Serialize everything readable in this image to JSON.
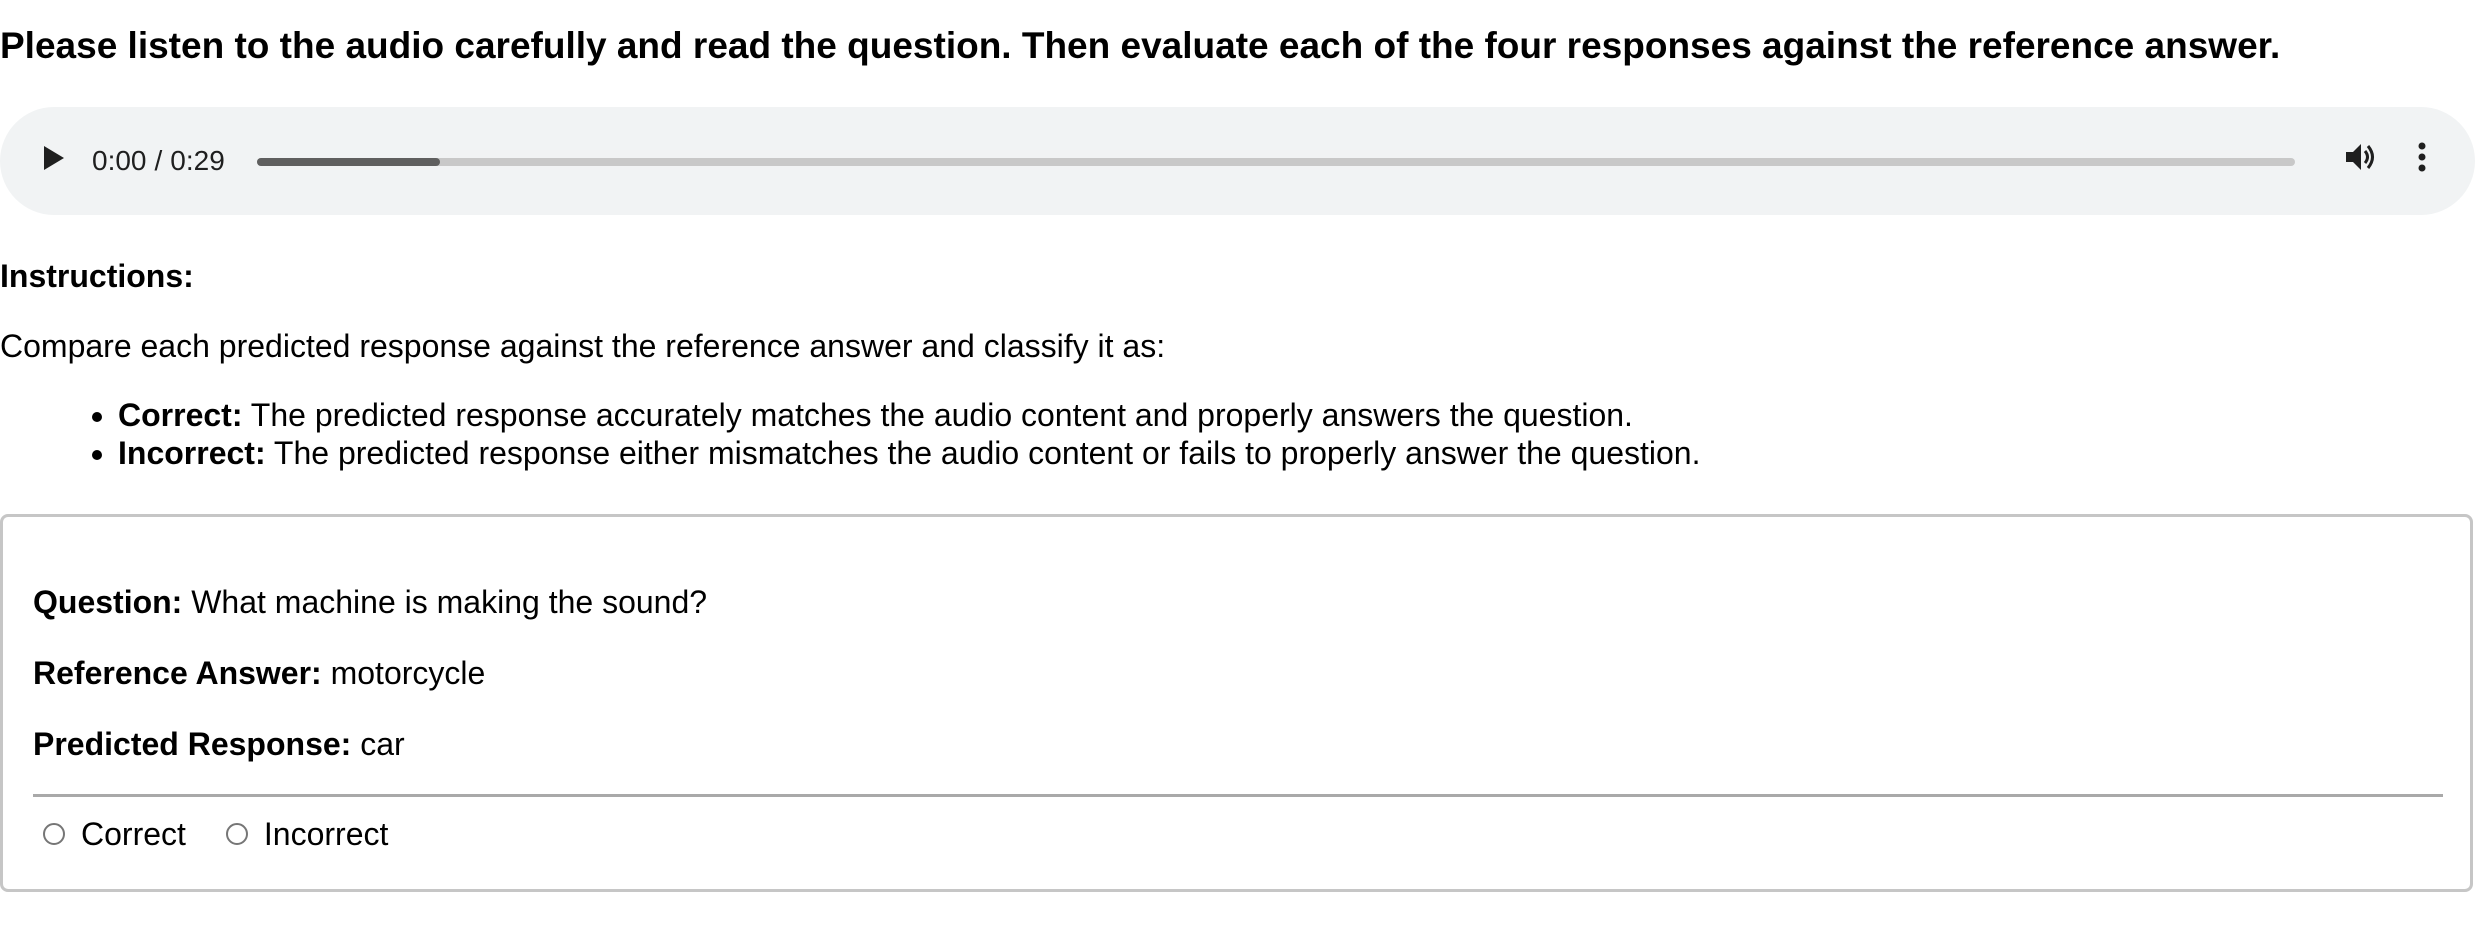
{
  "heading": "Please listen to the audio carefully and read the question. Then evaluate each of the four responses against the reference answer.",
  "audio_player": {
    "current_time": "0:00",
    "separator": "/",
    "duration": "0:29",
    "progress_fraction": 0.09,
    "play_icon": "play-icon",
    "volume_icon": "volume-icon",
    "more_icon": "more-vertical-icon"
  },
  "instructions": {
    "heading": "Instructions:",
    "text": "Compare each predicted response against the reference answer and classify it as:",
    "criteria": [
      {
        "label": "Correct:",
        "description": " The predicted response accurately matches the audio content and properly answers the question."
      },
      {
        "label": "Incorrect:",
        "description": " The predicted response either mismatches the audio content or fails to properly answer the question."
      }
    ]
  },
  "evaluation": {
    "question_label": "Question:",
    "question": " What machine is making the sound?",
    "reference_label": "Reference Answer:",
    "reference": " motorcycle",
    "predicted_label": "Predicted Response:",
    "predicted": " car",
    "options": [
      "Correct",
      "Incorrect"
    ]
  },
  "colors": {
    "player_background": "#f1f3f4",
    "progress_track": "#c8c8c8",
    "progress_fill": "#5f5f5f",
    "card_border": "#c6c6c6"
  }
}
